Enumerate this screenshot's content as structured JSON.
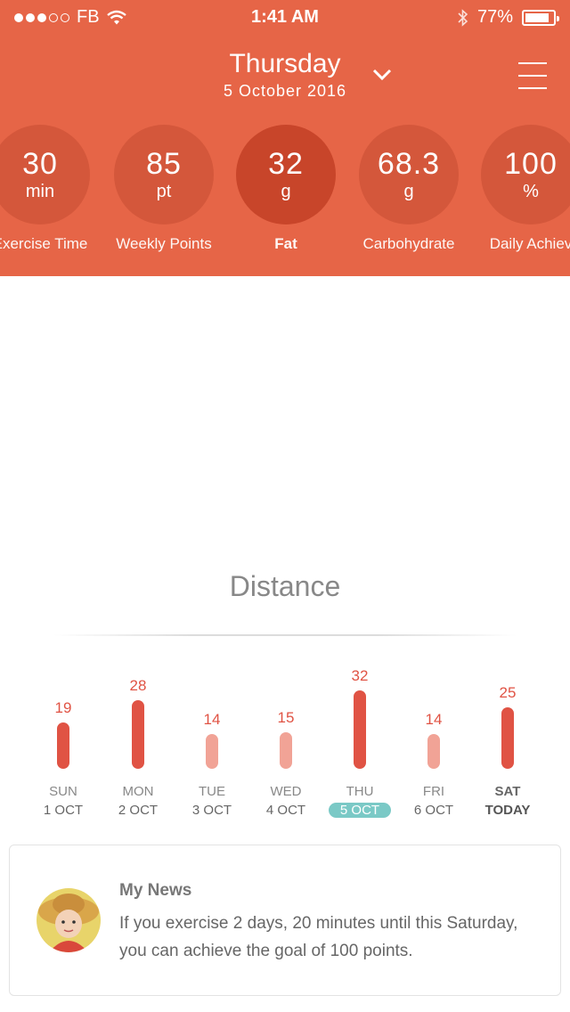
{
  "status_bar": {
    "carrier": "FB",
    "time": "1:41 AM",
    "battery": "77%"
  },
  "header": {
    "weekday": "Thursday",
    "date": "5 October 2016"
  },
  "stats": [
    {
      "value": "30",
      "unit": "min",
      "label": "Exercise Time",
      "active": false
    },
    {
      "value": "85",
      "unit": "pt",
      "label": "Weekly Points",
      "active": false
    },
    {
      "value": "32",
      "unit": "g",
      "label": "Fat",
      "active": true
    },
    {
      "value": "68.3",
      "unit": "g",
      "label": "Carbohydrate",
      "active": false
    },
    {
      "value": "100",
      "unit": "%",
      "label": "Daily Achiev",
      "active": false
    }
  ],
  "distance": {
    "title": "Distance",
    "days": [
      {
        "value": "19",
        "weekday": "SUN",
        "date": "1 OCT"
      },
      {
        "value": "28",
        "weekday": "MON",
        "date": "2 OCT"
      },
      {
        "value": "14",
        "weekday": "TUE",
        "date": "3 OCT"
      },
      {
        "value": "15",
        "weekday": "WED",
        "date": "4 OCT"
      },
      {
        "value": "32",
        "weekday": "THU",
        "date": "5 OCT"
      },
      {
        "value": "14",
        "weekday": "FRI",
        "date": "6 OCT"
      },
      {
        "value": "25",
        "weekday": "SAT",
        "date": "TODAY"
      }
    ]
  },
  "news": {
    "title": "My News",
    "text": "If you exercise 2 days, 20 minutes until this Saturday, you can achieve the goal of 100 points."
  },
  "colors": {
    "header_bg": "#e66547",
    "bar_dark": "#e05344",
    "bar_light": "#f1a396",
    "selected_pill": "#7ac9c6"
  }
}
